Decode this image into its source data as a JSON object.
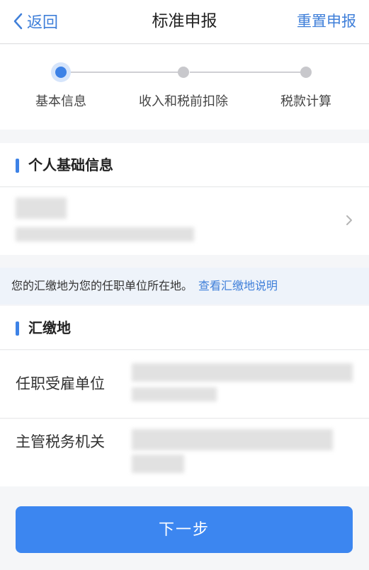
{
  "nav": {
    "back_label": "返回",
    "title": "标准申报",
    "reset_label": "重置申报"
  },
  "steps": [
    {
      "label": "基本信息",
      "active": true
    },
    {
      "label": "收入和税前扣除",
      "active": false
    },
    {
      "label": "税款计算",
      "active": false
    }
  ],
  "personal": {
    "section_title": "个人基础信息"
  },
  "notice": {
    "text": "您的汇缴地为您的任职单位所在地。",
    "link": "查看汇缴地说明"
  },
  "huijiao": {
    "section_title": "汇缴地",
    "employer_label": "任职受雇单位",
    "tax_office_label": "主管税务机关"
  },
  "footer": {
    "next_label": "下一步"
  },
  "colors": {
    "accent": "#3d82e6",
    "button": "#3c86f0"
  }
}
